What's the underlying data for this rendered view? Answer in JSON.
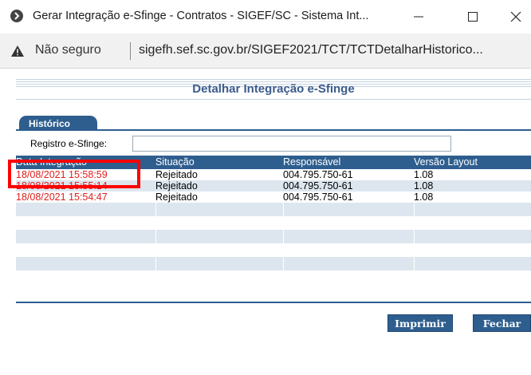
{
  "window": {
    "title": "Gerar Integração e-Sfinge - Contratos - SIGEF/SC - Sistema Int...",
    "min_glyph": "—",
    "max_glyph": "☐",
    "close_glyph": "✕"
  },
  "address": {
    "not_secure_label": "Não seguro",
    "url": "sigefh.sef.sc.gov.br/SIGEF2021/TCT/TCTDetalharHistorico..."
  },
  "page": {
    "title": "Detalhar Integração e-Sfinge",
    "tab_label": "Histórico",
    "registro_label": "Registro e-Sfinge:",
    "registro_value": ""
  },
  "table": {
    "headers": [
      "Data Integração",
      "Situação",
      "Responsável",
      "Versão Layout"
    ],
    "rows": [
      [
        "18/08/2021 15:58:59",
        "Rejeitado",
        "004.795.750-61",
        "1.08"
      ],
      [
        "18/08/2021 15:55:14",
        "Rejeitado",
        "004.795.750-61",
        "1.08"
      ],
      [
        "18/08/2021 15:54:47",
        "Rejeitado",
        "004.795.750-61",
        "1.08"
      ]
    ]
  },
  "buttons": {
    "print_label": "Imprimir",
    "close_label": "Fechar"
  },
  "colors": {
    "accent": "#2e5e8e",
    "date_red": "#e0201e",
    "highlight": "#ff0000",
    "row_alt": "#dde6ee"
  }
}
